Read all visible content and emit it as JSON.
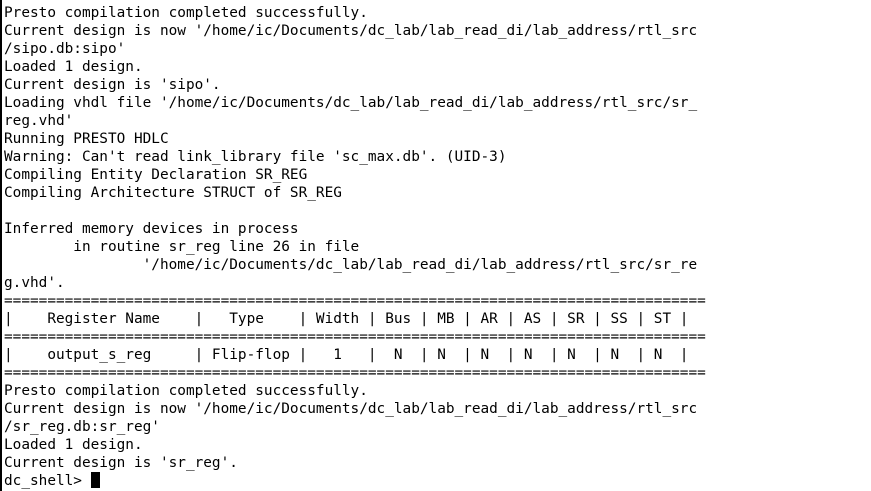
{
  "lines": [
    "Presto compilation completed successfully.",
    "Current design is now '/home/ic/Documents/dc_lab/lab_read_di/lab_address/rtl_src",
    "/sipo.db:sipo'",
    "Loaded 1 design.",
    "Current design is 'sipo'.",
    "Loading vhdl file '/home/ic/Documents/dc_lab/lab_read_di/lab_address/rtl_src/sr_",
    "reg.vhd'",
    "Running PRESTO HDLC",
    "Warning: Can't read link_library file 'sc_max.db'. (UID-3)",
    "Compiling Entity Declaration SR_REG",
    "Compiling Architecture STRUCT of SR_REG",
    "",
    "Inferred memory devices in process",
    "        in routine sr_reg line 26 in file",
    "                '/home/ic/Documents/dc_lab/lab_read_di/lab_address/rtl_src/sr_re",
    "g.vhd'.",
    "=================================================================================",
    "|    Register Name    |   Type    | Width | Bus | MB | AR | AS | SR | SS | ST |",
    "=================================================================================",
    "|    output_s_reg     | Flip-flop |   1   |  N  | N  | N  | N  | N  | N  | N  |",
    "=================================================================================",
    "Presto compilation completed successfully.",
    "Current design is now '/home/ic/Documents/dc_lab/lab_read_di/lab_address/rtl_src",
    "/sr_reg.db:sr_reg'",
    "Loaded 1 design.",
    "Current design is 'sr_reg'."
  ],
  "prompt": "dc_shell> "
}
